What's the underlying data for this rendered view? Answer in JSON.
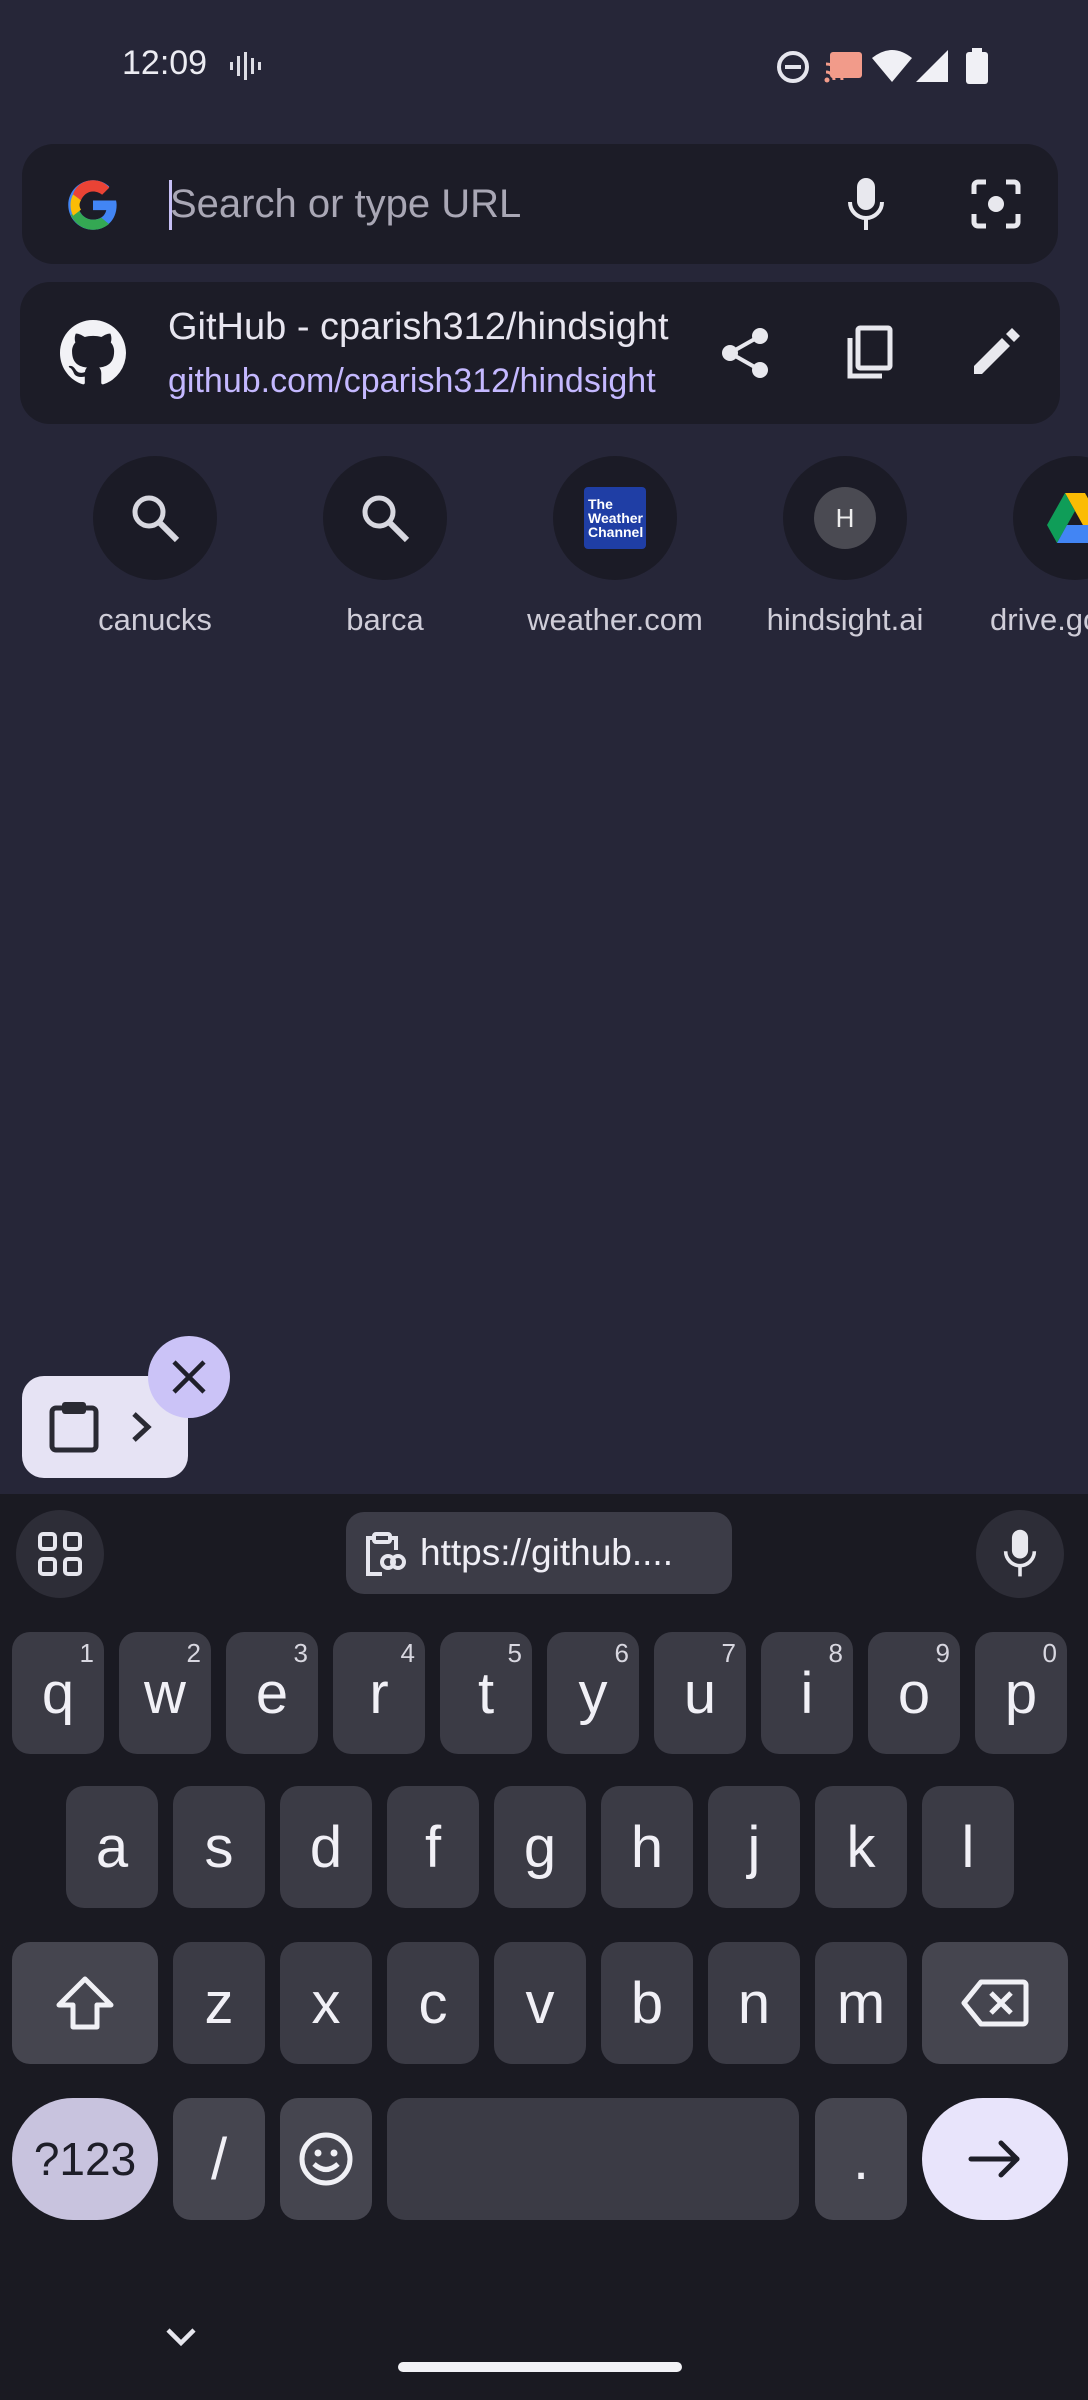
{
  "status": {
    "time": "12:09",
    "icons": [
      "voice-wave-icon",
      "do-not-disturb-icon",
      "cast-icon",
      "wifi-icon",
      "signal-icon",
      "battery-icon"
    ]
  },
  "search": {
    "placeholder": "Search or type URL",
    "icons": [
      "google-logo",
      "mic-icon",
      "lens-icon"
    ]
  },
  "suggestion": {
    "title": "GitHub - cparish312/hindsight",
    "url": "github.com/cparish312/hindsight",
    "actions": [
      "share-icon",
      "copy-icon",
      "edit-icon"
    ]
  },
  "tiles": [
    {
      "label": "canucks",
      "icon": "search-icon"
    },
    {
      "label": "barca",
      "icon": "search-icon"
    },
    {
      "label": "weather.com",
      "icon": "weather-channel-logo"
    },
    {
      "label": "hindsight.ai",
      "icon": "letter-badge",
      "badge": "H"
    },
    {
      "label": "drive.google.com",
      "icon": "drive-logo"
    }
  ],
  "weather_logo_text": [
    "The",
    "Weather",
    "Channel"
  ],
  "keyboard": {
    "clipboard_suggestion": "https://github....",
    "row1": [
      {
        "key": "q",
        "hint": "1"
      },
      {
        "key": "w",
        "hint": "2"
      },
      {
        "key": "e",
        "hint": "3"
      },
      {
        "key": "r",
        "hint": "4"
      },
      {
        "key": "t",
        "hint": "5"
      },
      {
        "key": "y",
        "hint": "6"
      },
      {
        "key": "u",
        "hint": "7"
      },
      {
        "key": "i",
        "hint": "8"
      },
      {
        "key": "o",
        "hint": "9"
      },
      {
        "key": "p",
        "hint": "0"
      }
    ],
    "row2": [
      "a",
      "s",
      "d",
      "f",
      "g",
      "h",
      "j",
      "k",
      "l"
    ],
    "row3": [
      "z",
      "x",
      "c",
      "v",
      "b",
      "n",
      "m"
    ],
    "symbols_key": "?123",
    "slash_key": "/",
    "period_key": "."
  },
  "colors": {
    "background": "#262638",
    "accent": "#c4b8ff",
    "enter_key": "#e8e4fb"
  }
}
